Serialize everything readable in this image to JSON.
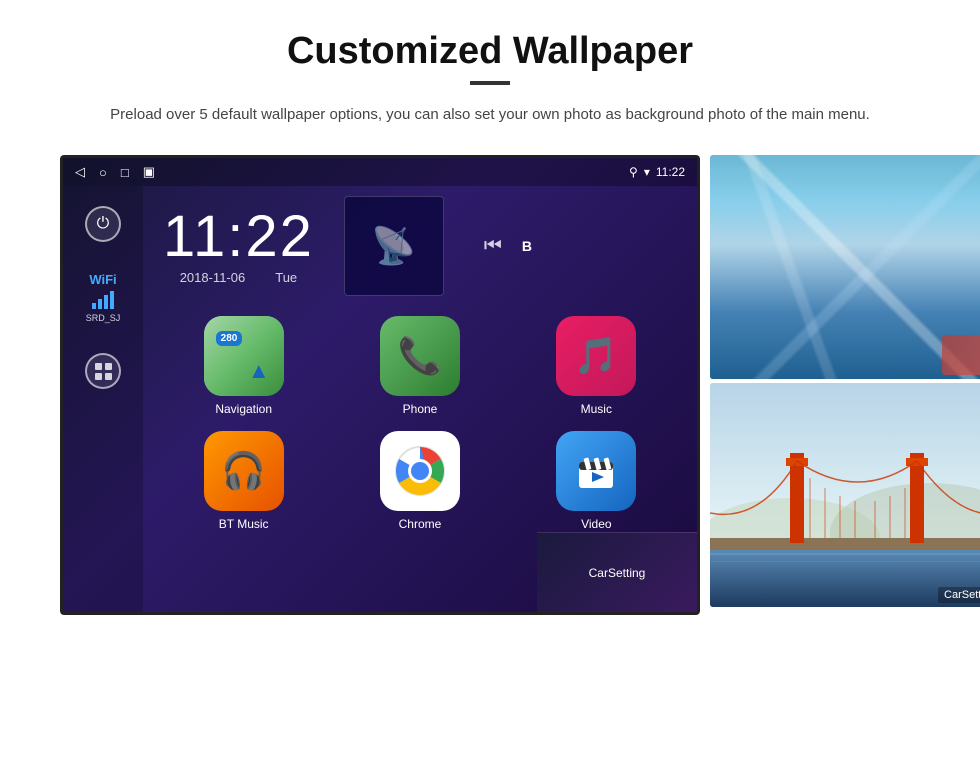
{
  "page": {
    "title": "Customized Wallpaper",
    "subtitle": "Preload over 5 default wallpaper options, you can also set your own photo as background photo of the main menu."
  },
  "statusBar": {
    "time": "11:22",
    "icons": [
      "◁",
      "○",
      "□",
      "▣"
    ],
    "rightIcons": [
      "location",
      "wifi",
      "signal"
    ]
  },
  "clock": {
    "time": "11:22",
    "date": "2018-11-06",
    "day": "Tue"
  },
  "wifi": {
    "label": "WiFi",
    "network": "SRD_SJ"
  },
  "apps": [
    {
      "name": "Navigation",
      "type": "nav",
      "icon": "🗺"
    },
    {
      "name": "Phone",
      "type": "phone",
      "icon": "📞"
    },
    {
      "name": "Music",
      "type": "music",
      "icon": "🎵"
    },
    {
      "name": "BT Music",
      "type": "bt",
      "icon": "🎧"
    },
    {
      "name": "Chrome",
      "type": "chrome",
      "icon": "⊕"
    },
    {
      "name": "Video",
      "type": "video",
      "icon": "▶"
    }
  ],
  "carsetting": {
    "label": "CarSetting"
  },
  "wallpaper": {
    "panel1_alt": "Ice cave blue wallpaper",
    "panel2_alt": "Golden Gate Bridge wallpaper"
  }
}
